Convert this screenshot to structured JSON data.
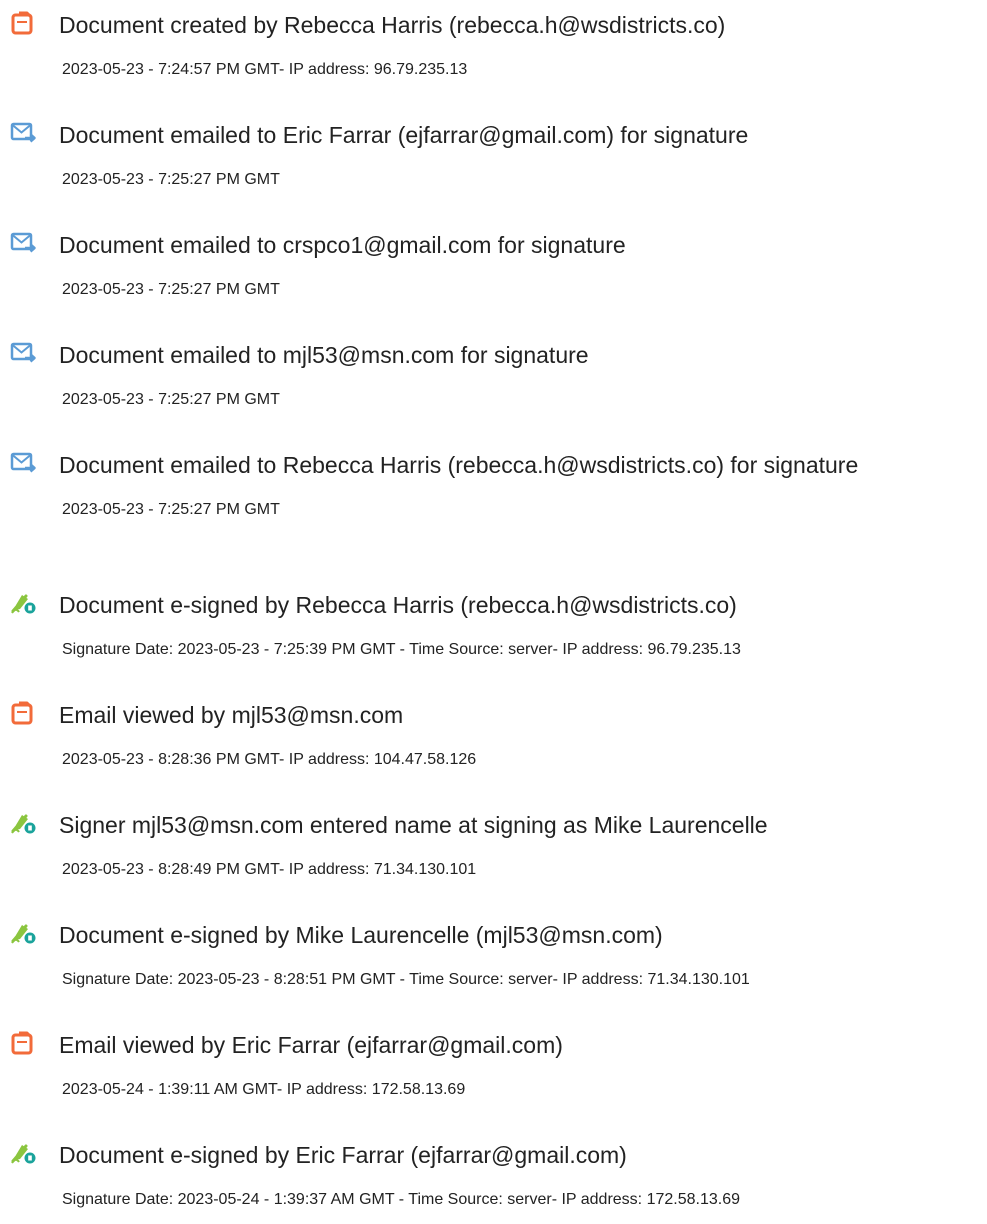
{
  "audit": {
    "entries": [
      {
        "icon": "document-created-icon",
        "title": "Document created by Rebecca Harris (rebecca.h@wsdistricts.co)",
        "detail": "2023-05-23 - 7:24:57 PM GMT- IP address: 96.79.235.13"
      },
      {
        "icon": "email-sent-icon",
        "title": "Document emailed to Eric Farrar (ejfarrar@gmail.com) for signature",
        "detail": "2023-05-23 - 7:25:27 PM GMT"
      },
      {
        "icon": "email-sent-icon",
        "title": "Document emailed to crspco1@gmail.com for signature",
        "detail": "2023-05-23 - 7:25:27 PM GMT"
      },
      {
        "icon": "email-sent-icon",
        "title": "Document emailed to mjl53@msn.com for signature",
        "detail": "2023-05-23 - 7:25:27 PM GMT"
      },
      {
        "icon": "email-sent-icon",
        "title": "Document emailed to Rebecca Harris (rebecca.h@wsdistricts.co) for signature",
        "detail": "2023-05-23 - 7:25:27 PM GMT"
      },
      {
        "icon": "e-sign-pen-icon",
        "title": "Document e-signed by Rebecca Harris (rebecca.h@wsdistricts.co)",
        "detail": "Signature Date: 2023-05-23 - 7:25:39 PM GMT - Time Source: server- IP address: 96.79.235.13"
      },
      {
        "icon": "document-viewed-icon",
        "title": "Email viewed by mjl53@msn.com",
        "detail": "2023-05-23 - 8:28:36 PM GMT- IP address: 104.47.58.126"
      },
      {
        "icon": "e-sign-pen-icon",
        "title": "Signer mjl53@msn.com entered name at signing as Mike Laurencelle",
        "detail": "2023-05-23 - 8:28:49 PM GMT- IP address: 71.34.130.101"
      },
      {
        "icon": "e-sign-pen-icon",
        "title": "Document e-signed by Mike Laurencelle (mjl53@msn.com)",
        "detail": "Signature Date: 2023-05-23 - 8:28:51 PM GMT - Time Source: server- IP address: 71.34.130.101"
      },
      {
        "icon": "document-viewed-icon",
        "title": "Email viewed by Eric Farrar (ejfarrar@gmail.com)",
        "detail": "2023-05-24 - 1:39:11 AM GMT- IP address: 172.58.13.69"
      },
      {
        "icon": "e-sign-pen-icon",
        "title": "Document e-signed by Eric Farrar (ejfarrar@gmail.com)",
        "detail": "Signature Date: 2023-05-24 - 1:39:37 AM GMT - Time Source: server- IP address: 172.58.13.69"
      }
    ]
  },
  "colors": {
    "document_icon": "#f26b3a",
    "email_icon": "#5b9bd5",
    "sign_pen_icon": "#8bc53f",
    "sign_badge": "#1aa39b",
    "text": "#222222"
  }
}
